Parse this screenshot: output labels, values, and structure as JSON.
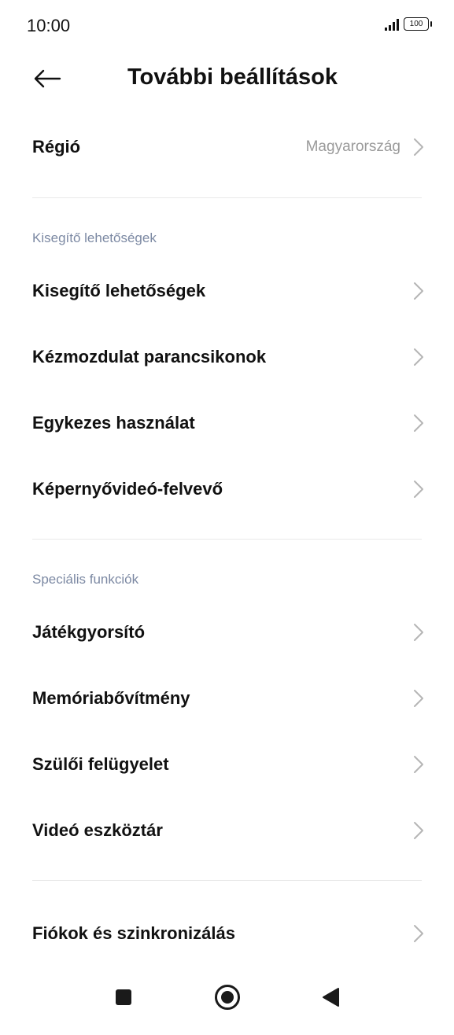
{
  "status_bar": {
    "time": "10:00",
    "battery": "100"
  },
  "header": {
    "title": "További beállítások",
    "back_icon": "arrow-left-icon"
  },
  "region_row": {
    "label": "Régió",
    "value": "Magyarország"
  },
  "sections": [
    {
      "header": "Kisegítő lehetőségek",
      "items": [
        {
          "label": "Kisegítő lehetőségek"
        },
        {
          "label": "Kézmozdulat parancsikonok"
        },
        {
          "label": "Egykezes használat"
        },
        {
          "label": "Képernyővideó-felvevő"
        }
      ]
    },
    {
      "header": "Speciális funkciók",
      "items": [
        {
          "label": "Játékgyorsító"
        },
        {
          "label": "Memóriabővítmény"
        },
        {
          "label": "Szülői felügyelet"
        },
        {
          "label": "Videó eszköztár"
        }
      ]
    }
  ],
  "accounts_row": {
    "label": "Fiókok és szinkronizálás"
  },
  "nav_bar": {
    "recents_icon": "square-icon",
    "home_icon": "circle-icon",
    "back_icon": "triangle-back-icon"
  },
  "colors": {
    "section_header": "#7c89a3",
    "value_text": "#9a9a9a",
    "chevron": "#b5b5b5",
    "divider": "#e9e9e9"
  }
}
